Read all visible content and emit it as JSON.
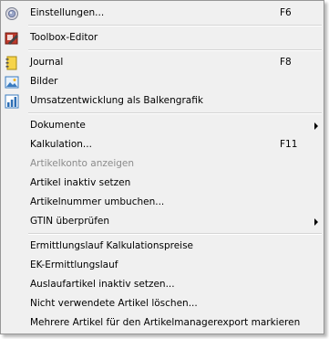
{
  "menu": {
    "settings": {
      "label": "Einstellungen...",
      "shortcut": "F6",
      "icon": "settings-icon"
    },
    "toolbox_editor": {
      "label": "Toolbox-Editor",
      "icon": "toolbox-editor-icon"
    },
    "journal": {
      "label": "Journal",
      "shortcut": "F8",
      "icon": "journal-icon"
    },
    "images": {
      "label": "Bilder",
      "icon": "images-icon"
    },
    "sales_chart": {
      "label": "Umsatzentwicklung als Balkengrafik",
      "icon": "bar-chart-icon"
    },
    "documents": {
      "label": "Dokumente"
    },
    "calculation": {
      "label": "Kalkulation...",
      "shortcut": "F11"
    },
    "article_account": {
      "label": "Artikelkonto anzeigen",
      "disabled": true
    },
    "set_inactive": {
      "label": "Artikel inaktiv setzen"
    },
    "rebook_number": {
      "label": "Artikelnummer umbuchen..."
    },
    "check_gtin": {
      "label": "GTIN überprüfen"
    },
    "calc_prices_run": {
      "label": "Ermittlungslauf Kalkulationspreise"
    },
    "ek_run": {
      "label": "EK-Ermittlungslauf"
    },
    "discontinued_inactive": {
      "label": "Auslaufartikel inaktiv setzen..."
    },
    "delete_unused": {
      "label": "Nicht verwendete Artikel löschen..."
    },
    "mark_for_export": {
      "label": "Mehrere Artikel für den Artikelmanagerexport markieren"
    }
  },
  "colors": {
    "menu_background": "#f0f0f0",
    "disabled_text": "#8b8b8b",
    "border": "#979797"
  }
}
